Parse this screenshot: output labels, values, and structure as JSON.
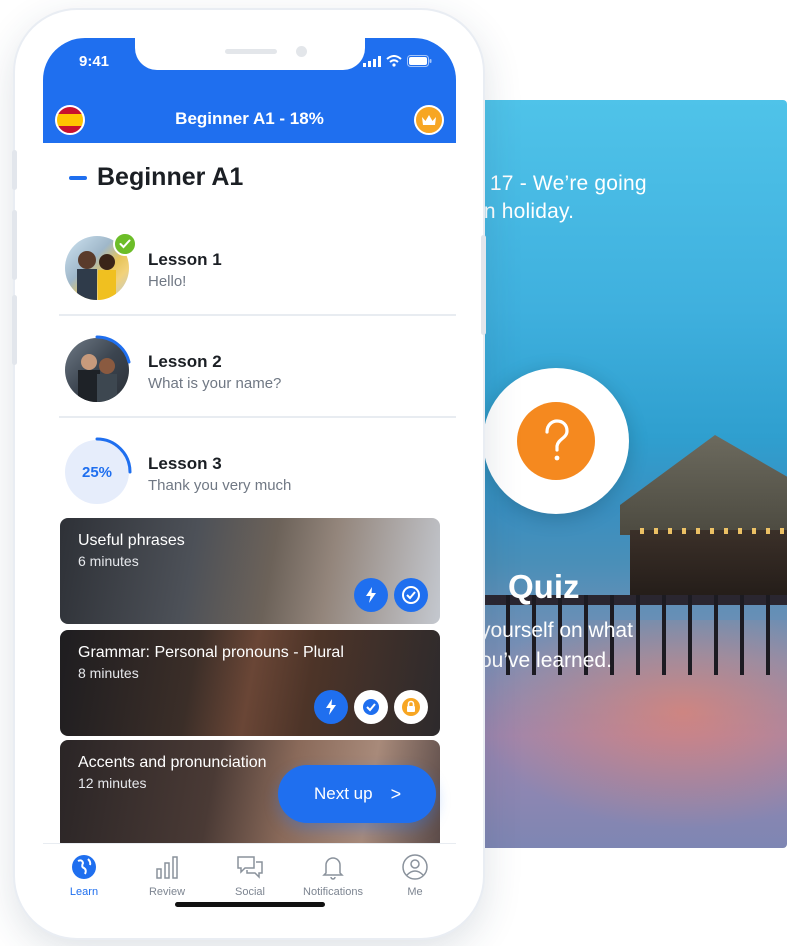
{
  "background_card": {
    "top_text": "n 17 - We’re going\n on holiday.",
    "quiz_title": "Quiz",
    "quiz_subtitle": " yourself on what\nou’ve learned.",
    "quiz_icon": "question-mark-icon"
  },
  "status_bar": {
    "time": "9:41"
  },
  "header": {
    "title": "Beginner A1 - 18%",
    "flag_icon": "spain-flag-icon",
    "crown_icon": "crown-icon"
  },
  "level": {
    "title": "Beginner A1"
  },
  "lessons": [
    {
      "name": "Lesson 1",
      "subtitle": "Hello!",
      "completed": true
    },
    {
      "name": "Lesson 2",
      "subtitle": "What is your name?",
      "progress": 0.3
    },
    {
      "name": "Lesson 3",
      "subtitle": "Thank you very much",
      "progress_label": "25%",
      "progress": 0.25
    }
  ],
  "activities": [
    {
      "title": "Useful phrases",
      "duration": "6 minutes"
    },
    {
      "title": "Grammar: Personal pronouns - Plural",
      "duration": "8 minutes"
    },
    {
      "title": "Accents and pronunciation",
      "duration": "12 minutes"
    }
  ],
  "next_up": {
    "label": "Next up",
    "chevron": ">"
  },
  "tabs": [
    {
      "label": "Learn",
      "icon": "globe-icon",
      "active": true
    },
    {
      "label": "Review",
      "icon": "bar-chart-icon",
      "active": false
    },
    {
      "label": "Social",
      "icon": "chat-bubbles-icon",
      "active": false
    },
    {
      "label": "Notifications",
      "icon": "bell-icon",
      "active": false
    },
    {
      "label": "Me",
      "icon": "profile-icon",
      "active": false
    }
  ],
  "colors": {
    "brand_blue": "#1f6fef",
    "quiz_orange": "#f5891f",
    "check_green": "#6cbd28",
    "lock_orange": "#f7a623"
  }
}
